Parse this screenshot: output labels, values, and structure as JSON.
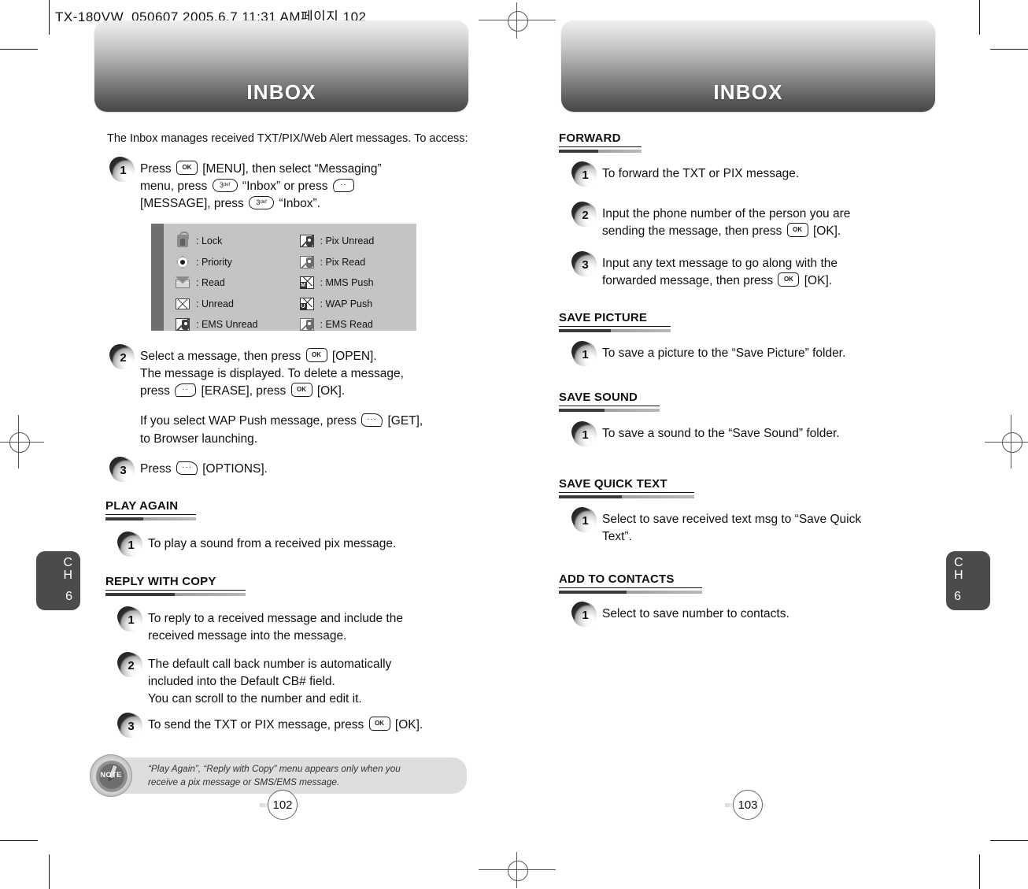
{
  "print_slug": "TX-180VW_050607  2005.6.7 11:31 AM페이지 102",
  "left_page": {
    "banner_title": "INBOX",
    "intro": "The Inbox manages received TXT/PIX/Web Alert messages. To access:",
    "steps": [
      {
        "num": "1",
        "lines": [
          "Press [KEY_OK] [MENU], then select “Messaging”",
          "menu, press [KEY_3] “Inbox” or press [KEY_SOFT_L]",
          "[MESSAGE], press [KEY_3] “Inbox”."
        ]
      },
      {
        "num": "2",
        "lines": [
          "Select a message, then press [KEY_OK] [OPEN].",
          "The message is displayed. To delete a message,",
          "press [KEY_SOFT_L] [ERASE], press [KEY_OK] [OK]."
        ],
        "lines2": [
          "If you select WAP Push message, press [KEY_SOFT_R] [GET],",
          "to Browser launching."
        ]
      },
      {
        "num": "3",
        "lines": [
          "Press [KEY_SOFT_R] [OPTIONS]."
        ]
      }
    ],
    "legend": [
      {
        "icon": "lock-icon",
        "label": ": Lock"
      },
      {
        "icon": "pix-unread-icon",
        "label": ": Pix Unread"
      },
      {
        "icon": "priority-icon",
        "label": ": Priority"
      },
      {
        "icon": "pix-read-icon",
        "label": ": Pix Read"
      },
      {
        "icon": "read-icon",
        "label": ": Read"
      },
      {
        "icon": "mms-push-icon",
        "label": ": MMS Push"
      },
      {
        "icon": "unread-icon",
        "label": ": Unread"
      },
      {
        "icon": "wap-push-icon",
        "label": ": WAP Push"
      },
      {
        "icon": "ems-unread-icon",
        "label": ": EMS Unread"
      },
      {
        "icon": "ems-read-icon",
        "label": ": EMS Read"
      }
    ],
    "sections": [
      {
        "heading": "PLAY AGAIN",
        "steps": [
          {
            "num": "1",
            "lines": [
              "To play a sound from a received pix message."
            ]
          }
        ]
      },
      {
        "heading": "REPLY WITH COPY",
        "steps": [
          {
            "num": "1",
            "lines": [
              "To reply to a received message and include the",
              "received message into the message."
            ]
          },
          {
            "num": "2",
            "lines": [
              "The default call back number is automatically",
              "included into the Default CB# field.",
              "You can scroll to the number and edit it."
            ]
          },
          {
            "num": "3",
            "lines": [
              "To send the TXT or PIX message, press [KEY_OK] [OK]."
            ]
          }
        ]
      }
    ],
    "note": {
      "badge_label": "NOTE",
      "line1": "“Play Again”, “Reply with Copy” menu appears only when you",
      "line2": "receive a pix message or SMS/EMS message."
    },
    "chapter_tab": {
      "ch_c": "C",
      "ch_h": "H",
      "number": "6"
    },
    "page_number": "102"
  },
  "right_page": {
    "banner_title": "INBOX",
    "sections": [
      {
        "heading": "FORWARD",
        "steps": [
          {
            "num": "1",
            "lines": [
              "To forward the TXT or PIX message."
            ]
          },
          {
            "num": "2",
            "lines": [
              "Input the phone number of the person you are",
              "sending the message, then press [KEY_OK] [OK]."
            ]
          },
          {
            "num": "3",
            "lines": [
              "Input any text message to go along with the",
              "forwarded message, then press [KEY_OK] [OK]."
            ]
          }
        ]
      },
      {
        "heading": "SAVE PICTURE",
        "steps": [
          {
            "num": "1",
            "lines": [
              "To save a picture to the “Save Picture” folder."
            ]
          }
        ]
      },
      {
        "heading": "SAVE SOUND",
        "steps": [
          {
            "num": "1",
            "lines": [
              "To save a sound to the “Save Sound” folder."
            ]
          }
        ]
      },
      {
        "heading": "SAVE QUICK TEXT",
        "steps": [
          {
            "num": "1",
            "lines": [
              "Select to save received text msg to “Save Quick",
              "Text”."
            ]
          }
        ]
      },
      {
        "heading": "ADD TO CONTACTS",
        "steps": [
          {
            "num": "1",
            "lines": [
              "Select to save number to contacts."
            ]
          }
        ]
      }
    ],
    "chapter_tab": {
      "ch_c": "C",
      "ch_h": "H",
      "number": "6"
    },
    "page_number": "103"
  },
  "keys": {
    "ok": "OK",
    "three": "3",
    "three_sub": "def",
    "soft_dots": "··"
  },
  "colors": {
    "banner_top": "#efefef",
    "banner_bottom": "#474747",
    "legend_bg": "#c4c4c4",
    "legend_edge": "#6f6f6f",
    "note_bg": "#dedede",
    "tab_bg": "#4b4b4b",
    "rule_dark": "#3a3a3a",
    "rule_light": "#b0b0b0"
  }
}
